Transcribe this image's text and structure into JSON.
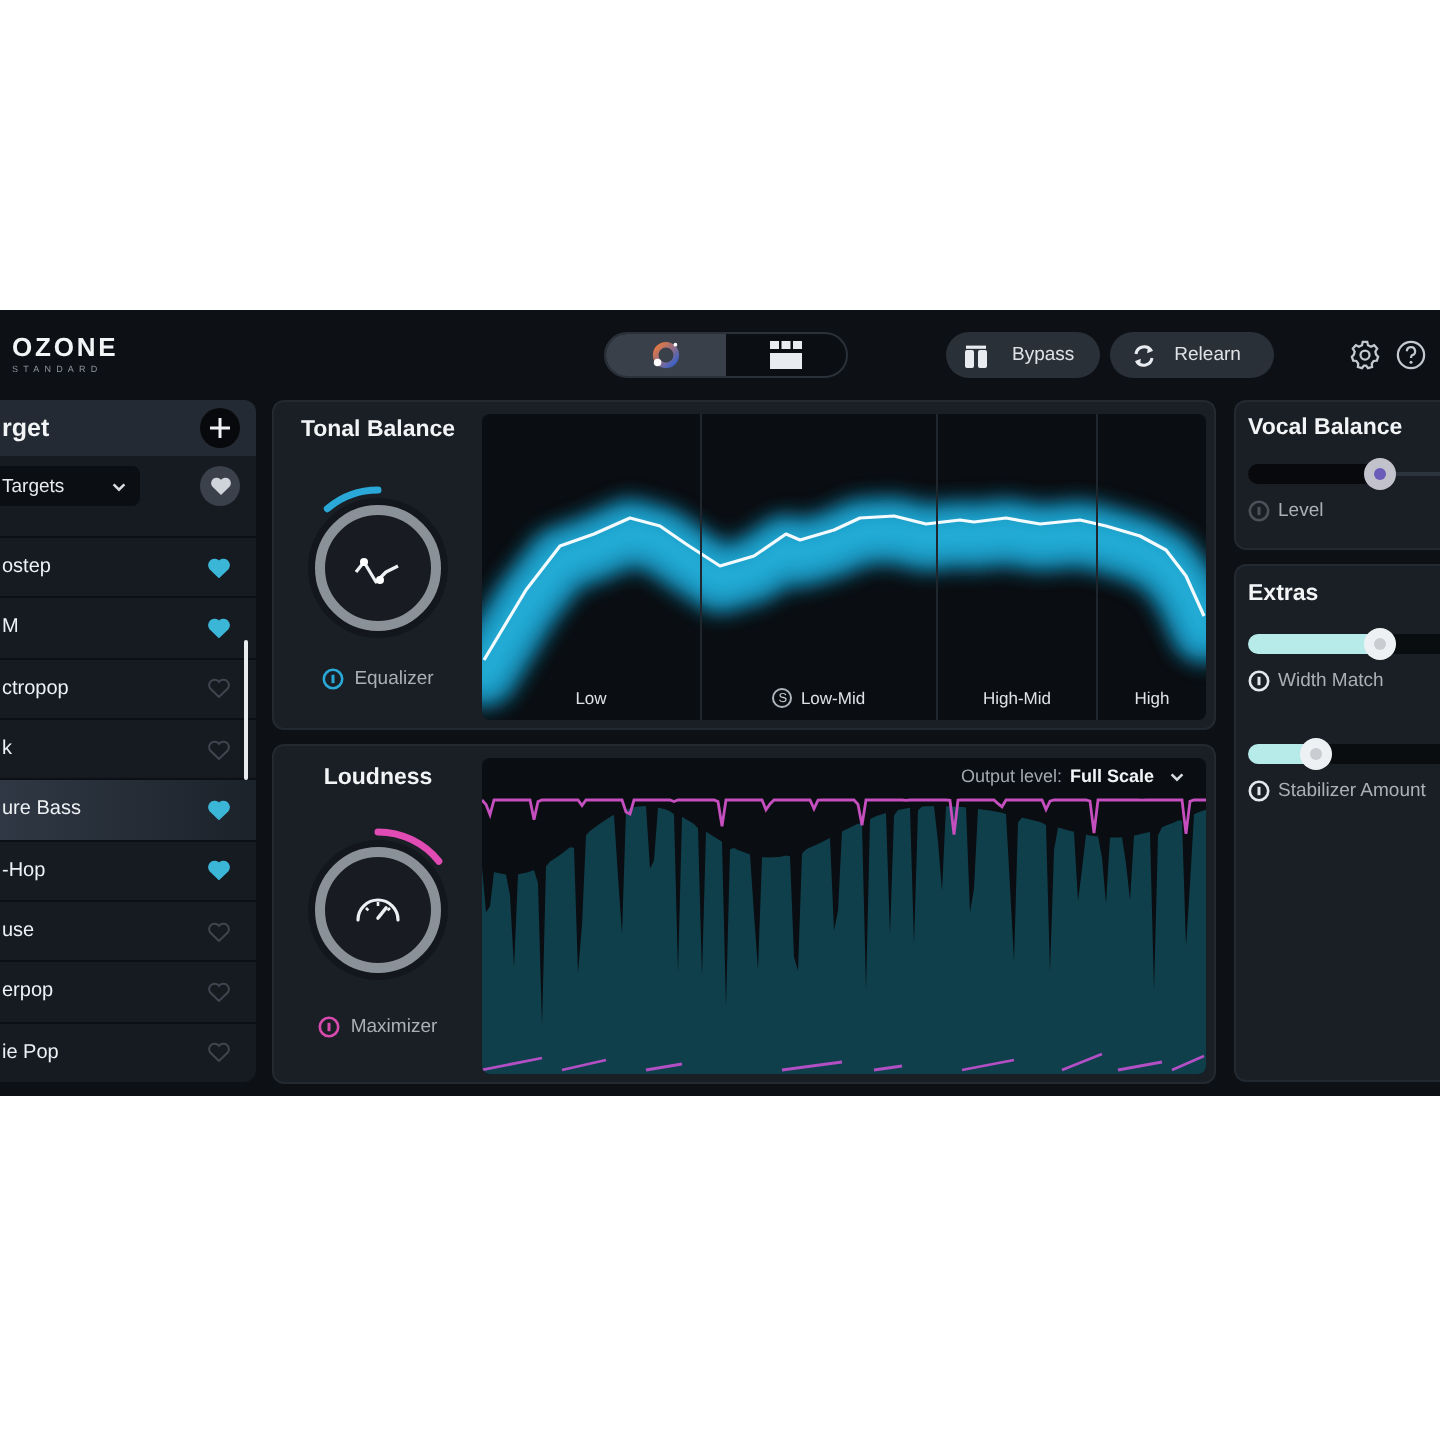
{
  "header": {
    "logo": "OZONE",
    "edition": "STANDARD",
    "views": [
      {
        "kind": "assistant",
        "selected": true
      },
      {
        "kind": "modules",
        "selected": false
      }
    ],
    "buttons": [
      {
        "kind": "bypass",
        "label": "Bypass"
      },
      {
        "kind": "relearn",
        "label": "Relearn"
      }
    ]
  },
  "target": {
    "title": "rget",
    "dropdown": "Targets",
    "items": [
      {
        "label": "ostep",
        "favorite": true,
        "selected": false
      },
      {
        "label": "M",
        "favorite": true,
        "selected": false
      },
      {
        "label": "ctropop",
        "favorite": false,
        "selected": false
      },
      {
        "label": "k",
        "favorite": false,
        "selected": false
      },
      {
        "label": "ure Bass",
        "favorite": true,
        "selected": true
      },
      {
        "label": "-Hop",
        "favorite": true,
        "selected": false
      },
      {
        "label": "use",
        "favorite": false,
        "selected": false
      },
      {
        "label": "erpop",
        "favorite": false,
        "selected": false
      },
      {
        "label": "ie Pop",
        "favorite": false,
        "selected": false
      }
    ]
  },
  "tonal_balance": {
    "title": "Tonal Balance",
    "knob": {
      "level": 0.35
    },
    "module": {
      "label": "Equalizer",
      "on": true
    },
    "bands": [
      {
        "label": "Low"
      },
      {
        "label": "Low-Mid",
        "marker": "S"
      },
      {
        "label": "High-Mid"
      },
      {
        "label": "High"
      }
    ]
  },
  "loudness": {
    "title": "Loudness",
    "knob": {
      "level": 0.69
    },
    "module": {
      "label": "Maximizer",
      "on": true
    },
    "output_label": "Output level:",
    "output_value": "Full Scale"
  },
  "vocal_balance": {
    "title": "Vocal Balance",
    "slider": {
      "level": 0.69
    },
    "module": {
      "label": "Level",
      "on": false
    }
  },
  "extras": {
    "title": "Extras",
    "sliders": [
      {
        "label": "Width Match",
        "level": 0.69,
        "on": true
      },
      {
        "label": "Stabilizer Amount",
        "level": 0.35,
        "on": true
      }
    ]
  }
}
